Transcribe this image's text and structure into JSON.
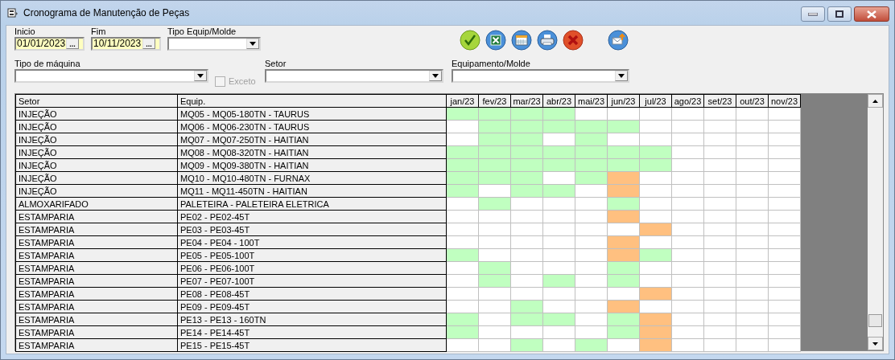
{
  "window": {
    "title": "Cronograma de Manutenção de Peças"
  },
  "filters": {
    "start": {
      "label": "Inicio",
      "value": "01/01/2023",
      "button": "..."
    },
    "end": {
      "label": "Fim",
      "value": "10/11/2023",
      "button": "..."
    },
    "equip_type": {
      "label": "Tipo Equip/Molde"
    },
    "machine_type": {
      "label": "Tipo de máquina"
    },
    "except": {
      "label": "Exceto",
      "checked": false,
      "disabled": true
    },
    "sector": {
      "label": "Setor"
    },
    "equipment": {
      "label": "Equipamento/Molde"
    }
  },
  "table": {
    "columns": [
      "Setor",
      "Equip.",
      "jan/23",
      "fev/23",
      "mar/23",
      "abr/23",
      "mai/23",
      "jun/23",
      "jul/23",
      "ago/23",
      "set/23",
      "out/23",
      "nov/23"
    ],
    "rows": [
      {
        "sector": "INJEÇÃO",
        "equipment": "MQ05 - MQ05-180TN - TAURUS",
        "cells": [
          {
            "color": "#c0ffc0"
          },
          {
            "color": "#c0ffc0"
          },
          {
            "color": "#c0ffc0"
          },
          {
            "color": "#c0ffc0"
          },
          {
            "color": "#ffffff"
          },
          {
            "color": "#ffffff"
          },
          {
            "color": "#ffffff"
          },
          {
            "color": "#ffffff"
          },
          {
            "color": "#ffffff"
          },
          {
            "color": "#ffffff"
          },
          {
            "color": "#ffffff"
          }
        ]
      },
      {
        "sector": "INJEÇÃO",
        "equipment": "MQ06 - MQ06-230TN - TAURUS",
        "cells": [
          {
            "color": "#ffffff"
          },
          {
            "color": "#c0ffc0"
          },
          {
            "color": "#c0ffc0"
          },
          {
            "color": "#c0ffc0"
          },
          {
            "color": "#c0ffc0"
          },
          {
            "color": "#c0ffc0"
          },
          {
            "color": "#ffffff"
          },
          {
            "color": "#ffffff"
          },
          {
            "color": "#ffffff"
          },
          {
            "color": "#ffffff"
          },
          {
            "color": "#ffffff"
          }
        ]
      },
      {
        "sector": "INJEÇÃO",
        "equipment": "MQ07 - MQ07-250TN - HAITIAN",
        "cells": [
          {
            "color": "#ffffff"
          },
          {
            "color": "#c0ffc0"
          },
          {
            "color": "#c0ffc0"
          },
          {
            "color": "#ffffff"
          },
          {
            "color": "#c0ffc0"
          },
          {
            "color": "#ffffff"
          },
          {
            "color": "#ffffff"
          },
          {
            "color": "#ffffff"
          },
          {
            "color": "#ffffff"
          },
          {
            "color": "#ffffff"
          },
          {
            "color": "#ffffff"
          }
        ]
      },
      {
        "sector": "INJEÇÃO",
        "equipment": "MQ08 - MQ08-320TN - HAITIAN",
        "cells": [
          {
            "color": "#c0ffc0"
          },
          {
            "color": "#c0ffc0"
          },
          {
            "color": "#c0ffc0"
          },
          {
            "color": "#c0ffc0"
          },
          {
            "color": "#c0ffc0"
          },
          {
            "color": "#c0ffc0"
          },
          {
            "color": "#c0ffc0"
          },
          {
            "color": "#ffffff"
          },
          {
            "color": "#ffffff"
          },
          {
            "color": "#ffffff"
          },
          {
            "color": "#ffffff"
          }
        ]
      },
      {
        "sector": "INJEÇÃO",
        "equipment": "MQ09 - MQ09-380TN - HAITIAN",
        "cells": [
          {
            "color": "#c0ffc0"
          },
          {
            "color": "#c0ffc0"
          },
          {
            "color": "#c0ffc0"
          },
          {
            "color": "#c0ffc0"
          },
          {
            "color": "#c0ffc0"
          },
          {
            "color": "#c0ffc0"
          },
          {
            "color": "#c0ffc0"
          },
          {
            "color": "#ffffff"
          },
          {
            "color": "#ffffff"
          },
          {
            "color": "#ffffff"
          },
          {
            "color": "#ffffff"
          }
        ]
      },
      {
        "sector": "INJEÇÃO",
        "equipment": "MQ10 - MQ10-480TN - FURNAX",
        "cells": [
          {
            "color": "#c0ffc0"
          },
          {
            "color": "#c0ffc0"
          },
          {
            "color": "#c0ffc0"
          },
          {
            "color": "#ffffff"
          },
          {
            "color": "#c0ffc0"
          },
          {
            "color": "#ffc080"
          },
          {
            "color": "#ffffff"
          },
          {
            "color": "#ffffff"
          },
          {
            "color": "#ffffff"
          },
          {
            "color": "#ffffff"
          },
          {
            "color": "#ffffff"
          }
        ]
      },
      {
        "sector": "INJEÇÃO",
        "equipment": "MQ11 - MQ11-450TN - HAITIAN",
        "cells": [
          {
            "color": "#c0ffc0"
          },
          {
            "color": "#ffffff"
          },
          {
            "color": "#c0ffc0"
          },
          {
            "color": "#c0ffc0"
          },
          {
            "color": "#ffffff"
          },
          {
            "color": "#ffc080"
          },
          {
            "color": "#ffffff"
          },
          {
            "color": "#ffffff"
          },
          {
            "color": "#ffffff"
          },
          {
            "color": "#ffffff"
          },
          {
            "color": "#ffffff"
          }
        ]
      },
      {
        "sector": "ALMOXARIFADO",
        "equipment": "PALETEIRA - PALETEIRA ELETRICA",
        "cells": [
          {
            "color": "#ffffff"
          },
          {
            "color": "#c0ffc0"
          },
          {
            "color": "#ffffff"
          },
          {
            "color": "#ffffff"
          },
          {
            "color": "#ffffff"
          },
          {
            "color": "#c0ffc0"
          },
          {
            "color": "#ffffff"
          },
          {
            "color": "#ffffff"
          },
          {
            "color": "#ffffff"
          },
          {
            "color": "#ffffff"
          },
          {
            "color": "#ffffff"
          }
        ]
      },
      {
        "sector": "ESTAMPARIA",
        "equipment": "PE02 - PE02-45T",
        "cells": [
          {
            "color": "#ffffff"
          },
          {
            "color": "#ffffff"
          },
          {
            "color": "#ffffff"
          },
          {
            "color": "#ffffff"
          },
          {
            "color": "#ffffff"
          },
          {
            "color": "#ffc080"
          },
          {
            "color": "#ffffff"
          },
          {
            "color": "#ffffff"
          },
          {
            "color": "#ffffff"
          },
          {
            "color": "#ffffff"
          },
          {
            "color": "#ffffff"
          }
        ]
      },
      {
        "sector": "ESTAMPARIA",
        "equipment": "PE03 - PE03-45T",
        "cells": [
          {
            "color": "#ffffff"
          },
          {
            "color": "#ffffff"
          },
          {
            "color": "#ffffff"
          },
          {
            "color": "#ffffff"
          },
          {
            "color": "#ffffff"
          },
          {
            "color": "#ffffff"
          },
          {
            "color": "#ffc080"
          },
          {
            "color": "#ffffff"
          },
          {
            "color": "#ffffff"
          },
          {
            "color": "#ffffff"
          },
          {
            "color": "#ffffff"
          }
        ]
      },
      {
        "sector": "ESTAMPARIA",
        "equipment": "PE04 - PE04 - 100T",
        "cells": [
          {
            "color": "#ffffff"
          },
          {
            "color": "#ffffff"
          },
          {
            "color": "#ffffff"
          },
          {
            "color": "#ffffff"
          },
          {
            "color": "#ffffff"
          },
          {
            "color": "#ffc080"
          },
          {
            "color": "#ffffff"
          },
          {
            "color": "#ffffff"
          },
          {
            "color": "#ffffff"
          },
          {
            "color": "#ffffff"
          },
          {
            "color": "#ffffff"
          }
        ]
      },
      {
        "sector": "ESTAMPARIA",
        "equipment": "PE05 - PE05-100T",
        "cells": [
          {
            "color": "#c0ffc0"
          },
          {
            "color": "#ffffff"
          },
          {
            "color": "#ffffff"
          },
          {
            "color": "#ffffff"
          },
          {
            "color": "#ffffff"
          },
          {
            "color": "#ffc080"
          },
          {
            "color": "#c0ffc0"
          },
          {
            "color": "#ffffff"
          },
          {
            "color": "#ffffff"
          },
          {
            "color": "#ffffff"
          },
          {
            "color": "#ffffff"
          }
        ]
      },
      {
        "sector": "ESTAMPARIA",
        "equipment": "PE06 - PE06-100T",
        "cells": [
          {
            "color": "#ffffff"
          },
          {
            "color": "#c0ffc0"
          },
          {
            "color": "#ffffff"
          },
          {
            "color": "#ffffff"
          },
          {
            "color": "#ffffff"
          },
          {
            "color": "#c0ffc0"
          },
          {
            "color": "#ffffff"
          },
          {
            "color": "#ffffff"
          },
          {
            "color": "#ffffff"
          },
          {
            "color": "#ffffff"
          },
          {
            "color": "#ffffff"
          }
        ]
      },
      {
        "sector": "ESTAMPARIA",
        "equipment": "PE07 - PE07-100T",
        "cells": [
          {
            "color": "#ffffff"
          },
          {
            "color": "#c0ffc0"
          },
          {
            "color": "#ffffff"
          },
          {
            "color": "#c0ffc0"
          },
          {
            "color": "#ffffff"
          },
          {
            "color": "#c0ffc0"
          },
          {
            "color": "#ffffff"
          },
          {
            "color": "#ffffff"
          },
          {
            "color": "#ffffff"
          },
          {
            "color": "#ffffff"
          },
          {
            "color": "#ffffff"
          }
        ]
      },
      {
        "sector": "ESTAMPARIA",
        "equipment": "PE08 - PE08-45T",
        "cells": [
          {
            "color": "#ffffff"
          },
          {
            "color": "#ffffff"
          },
          {
            "color": "#ffffff"
          },
          {
            "color": "#ffffff"
          },
          {
            "color": "#ffffff"
          },
          {
            "color": "#ffffff"
          },
          {
            "color": "#ffc080"
          },
          {
            "color": "#ffffff"
          },
          {
            "color": "#ffffff"
          },
          {
            "color": "#ffffff"
          },
          {
            "color": "#ffffff"
          }
        ]
      },
      {
        "sector": "ESTAMPARIA",
        "equipment": "PE09 - PE09-45T",
        "cells": [
          {
            "color": "#ffffff"
          },
          {
            "color": "#ffffff"
          },
          {
            "color": "#c0ffc0"
          },
          {
            "color": "#ffffff"
          },
          {
            "color": "#ffffff"
          },
          {
            "color": "#ffc080"
          },
          {
            "color": "#ffffff"
          },
          {
            "color": "#ffffff"
          },
          {
            "color": "#ffffff"
          },
          {
            "color": "#ffffff"
          },
          {
            "color": "#ffffff"
          }
        ]
      },
      {
        "sector": "ESTAMPARIA",
        "equipment": "PE13 - PE13 - 160TN",
        "cells": [
          {
            "color": "#c0ffc0"
          },
          {
            "color": "#ffffff"
          },
          {
            "color": "#c0ffc0"
          },
          {
            "color": "#c0ffc0"
          },
          {
            "color": "#ffffff"
          },
          {
            "color": "#c0ffc0"
          },
          {
            "color": "#ffc080"
          },
          {
            "color": "#ffffff"
          },
          {
            "color": "#ffffff"
          },
          {
            "color": "#ffffff"
          },
          {
            "color": "#ffffff"
          }
        ]
      },
      {
        "sector": "ESTAMPARIA",
        "equipment": "PE14 - PE14-45T",
        "cells": [
          {
            "color": "#c0ffc0"
          },
          {
            "color": "#ffffff"
          },
          {
            "color": "#ffffff"
          },
          {
            "color": "#ffffff"
          },
          {
            "color": "#ffffff"
          },
          {
            "color": "#c0ffc0"
          },
          {
            "color": "#ffc080"
          },
          {
            "color": "#ffffff"
          },
          {
            "color": "#ffffff"
          },
          {
            "color": "#ffffff"
          },
          {
            "color": "#ffffff"
          }
        ]
      },
      {
        "sector": "ESTAMPARIA",
        "equipment": "PE15 - PE15-45T",
        "cells": [
          {
            "color": "#ffffff"
          },
          {
            "color": "#ffffff"
          },
          {
            "color": "#c0ffc0"
          },
          {
            "color": "#ffffff"
          },
          {
            "color": "#c0ffc0"
          },
          {
            "color": "#ffffff"
          },
          {
            "color": "#ffc080"
          },
          {
            "color": "#ffffff"
          },
          {
            "color": "#ffffff"
          },
          {
            "color": "#ffffff"
          },
          {
            "color": "#ffffff"
          }
        ]
      }
    ]
  }
}
